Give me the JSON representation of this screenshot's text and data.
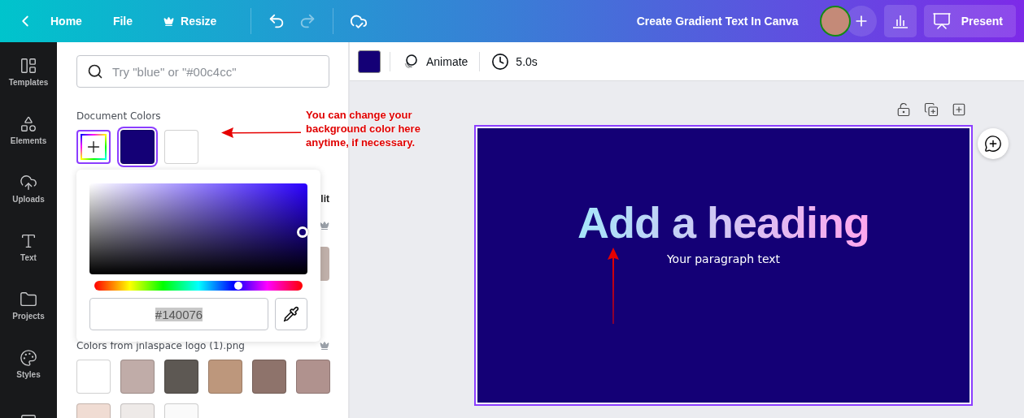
{
  "top_bar": {
    "nav": [
      {
        "label": "Home",
        "kind": "back"
      },
      {
        "label": "File",
        "kind": "plain"
      },
      {
        "label": "Resize",
        "kind": "premium"
      }
    ],
    "title": "Create Gradient Text In Canva",
    "present_label": "Present"
  },
  "rail": {
    "items": [
      {
        "label": "Templates",
        "kind": "templates"
      },
      {
        "label": "Elements",
        "kind": "elements"
      },
      {
        "label": "Uploads",
        "kind": "uploads"
      },
      {
        "label": "Text",
        "kind": "text"
      },
      {
        "label": "Projects",
        "kind": "projects"
      },
      {
        "label": "Styles",
        "kind": "styles"
      },
      {
        "kind": "video"
      }
    ]
  },
  "panel": {
    "search_placeholder": "Try \"blue\" or \"#00c4cc\"",
    "document_colors_title": "Document Colors",
    "document_colors": [
      {
        "kind": "add",
        "selected": false
      },
      {
        "kind": "swatch",
        "color": "#140076",
        "selected": true
      },
      {
        "kind": "swatch",
        "color": "#ffffff",
        "selected": false
      }
    ],
    "covered_link": "lit",
    "covered_swatch": {
      "color": "#c0b0aa"
    },
    "logo_colors_title": "Colors from jnlaspace logo (1).png",
    "logo_colors": [
      {
        "color": "#ffffff"
      },
      {
        "color": "#c0aca8"
      },
      {
        "color": "#5d5853"
      },
      {
        "color": "#bd977c"
      },
      {
        "color": "#8e736b"
      },
      {
        "color": "#b0928e"
      },
      {
        "color": "#f0dcd3"
      },
      {
        "color": "#eeeae8"
      },
      {
        "color": "#fafafa"
      }
    ]
  },
  "color_picker": {
    "hue": {
      "level": 0.69
    },
    "hex_value": "#140076"
  },
  "toolbar": {
    "color": "#140076",
    "animate_label": "Animate",
    "duration": "5.0s"
  },
  "design": {
    "heading": "Add a heading",
    "paragraph": "Your paragraph text"
  },
  "annotation": {
    "text": "You can change your background color here anytime, if necessary."
  }
}
